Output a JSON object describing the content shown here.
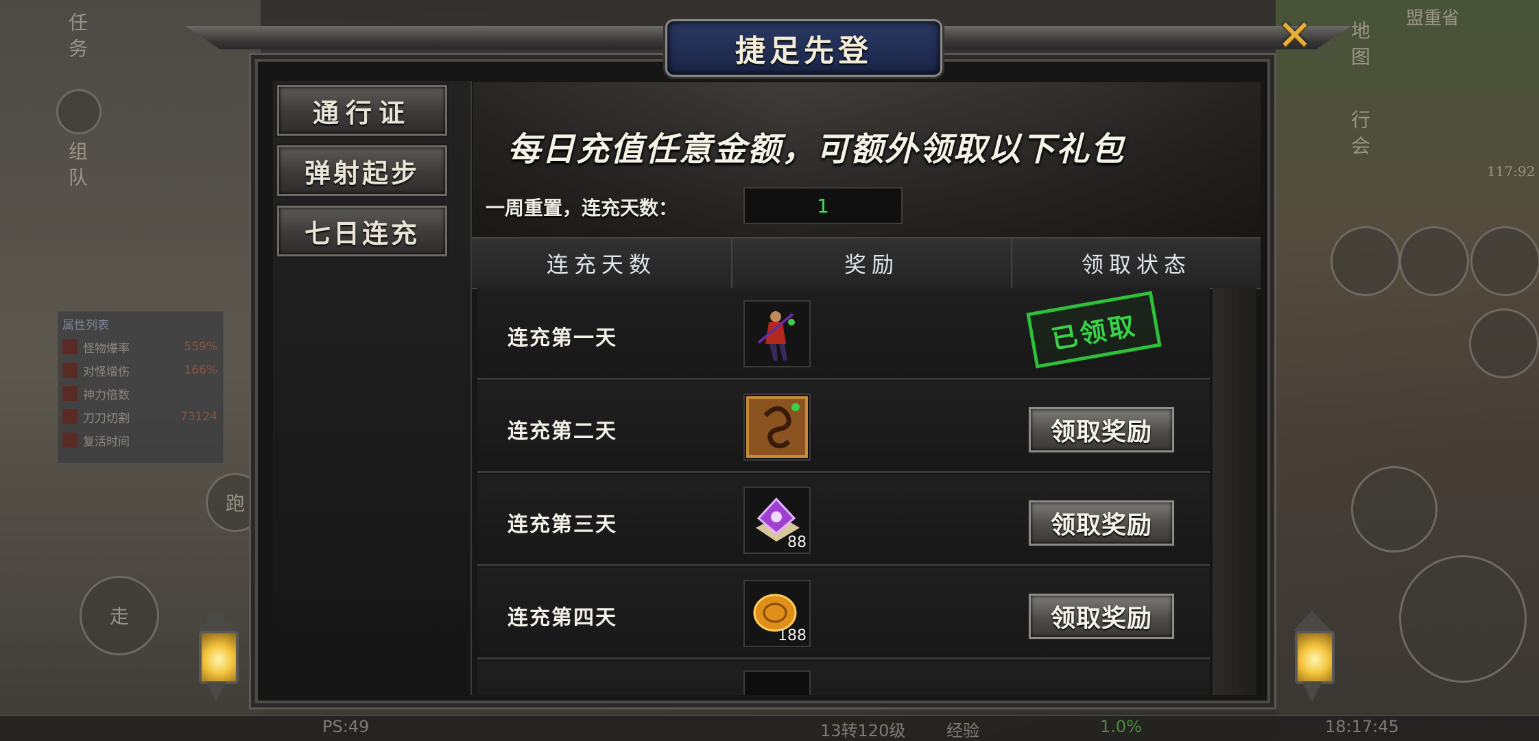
{
  "background": {
    "hud_left": {
      "task": "任务",
      "team": "组队",
      "run": "跑",
      "walk": "走"
    },
    "hud_right": {
      "map": "地图",
      "guild": "行会",
      "region": "盟重省",
      "time_right": "117:92"
    },
    "stat_list": {
      "title": "属性列表",
      "rows": [
        {
          "label": "怪物爆率",
          "value": "559%"
        },
        {
          "label": "对怪增伤",
          "value": "166%"
        },
        {
          "label": "神力倍数",
          "value": ""
        },
        {
          "label": "刀刀切割",
          "value": "73124"
        },
        {
          "label": "复活时间",
          "value": ""
        }
      ]
    },
    "bottom_bar": {
      "ps": "PS:49",
      "level": "13转120级",
      "exp_label": "经验",
      "exp_value": "1.0%",
      "clock": "18:17:45"
    }
  },
  "window": {
    "title": "捷足先登",
    "close_icon": "close-x-icon"
  },
  "tabs": [
    {
      "label": "通行证"
    },
    {
      "label": "弹射起步"
    },
    {
      "label": "七日连充"
    }
  ],
  "banner": {
    "headline": "每日充值任意金额，可额外领取以下礼包",
    "reset_label": "一周重置，连充天数：",
    "consecutive_days": "1"
  },
  "table": {
    "headers": [
      "连充天数",
      "奖励",
      "领取状态"
    ],
    "rows": [
      {
        "day": "连充第一天",
        "item_icon": "warrior-figure-icon",
        "qty": "",
        "status": "claimed",
        "status_text": "已领取"
      },
      {
        "day": "连充第二天",
        "item_icon": "dragon-tile-icon",
        "qty": "",
        "status": "claimable",
        "status_text": "领取奖励"
      },
      {
        "day": "连充第三天",
        "item_icon": "purple-crystal-icon",
        "qty": "88",
        "status": "claimable",
        "status_text": "领取奖励"
      },
      {
        "day": "连充第四天",
        "item_icon": "gold-coin-icon",
        "qty": "188",
        "status": "claimable",
        "status_text": "领取奖励"
      }
    ]
  },
  "colors": {
    "accent_green": "#3ee05a",
    "stamp_green": "#2fbf3b",
    "close_gold": "#e4b23c",
    "title_plate": "#1f2c56"
  }
}
